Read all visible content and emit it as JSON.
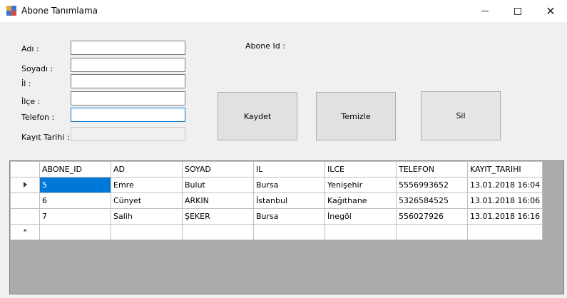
{
  "window": {
    "title": "Abone Tanımlama",
    "minimize": "—",
    "maximize": "☐",
    "close": "✕"
  },
  "form": {
    "ad_label": "Adı :",
    "soyad_label": "Soyadı :",
    "il_label": "İl :",
    "ilce_label": "İlçe :",
    "telefon_label": "Telefon :",
    "kayit_label": "Kayıt Tarihi :",
    "abone_id_label": "Abone Id :",
    "ad_value": "",
    "soyad_value": "",
    "il_value": "",
    "ilce_value": "",
    "telefon_value": "",
    "kayit_value": ""
  },
  "buttons": {
    "kaydet": "Kaydet",
    "temizle": "Temizle",
    "sil": "Sil"
  },
  "grid": {
    "columns": [
      "ABONE_ID",
      "AD",
      "SOYAD",
      "IL",
      "ILCE",
      "TELEFON",
      "KAYIT_TARIHI"
    ],
    "rows": [
      [
        "5",
        "Emre",
        "Bulut",
        "Bursa",
        "Yenişehir",
        "5556993652",
        "13.01.2018 16:04"
      ],
      [
        "6",
        "Cünyet",
        "ARKIN",
        "İstanbul",
        "Kağıthane",
        "5326584525",
        "13.01.2018 16:06"
      ],
      [
        "7",
        "Salih",
        "ŞEKER",
        "Bursa",
        "İnegöl",
        "556027926",
        "13.01.2018 16:16"
      ]
    ],
    "new_row_marker": "*"
  },
  "colors": {
    "selection": "#0078d7",
    "grid_background": "#ababab",
    "focus_border": "#0078d7"
  }
}
